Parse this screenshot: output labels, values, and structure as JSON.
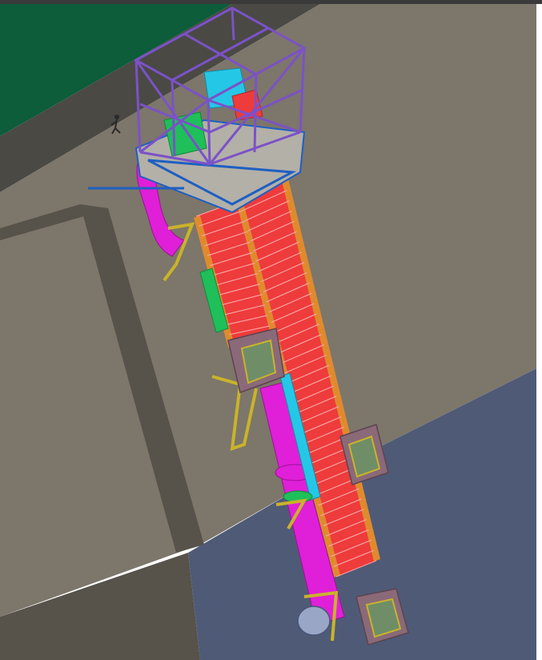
{
  "viewport": {
    "background": "#ffffff",
    "top_border_color": "#3a3a3a"
  },
  "scene": {
    "grass_color": "#0d5c3a",
    "road_color": "#4a4944",
    "wall_color": "#7d766a",
    "wall_shadow_color": "#57524a",
    "water_color": "#4f5a77",
    "steel_purple": "#7b52c7",
    "chute_red": "#ee3b3b",
    "rail_orange": "#e08a2e",
    "pipe_magenta": "#e01fd8",
    "cyan": "#25c7e6",
    "green": "#1fbf5a",
    "yellow": "#c9b32b",
    "blue": "#1f5fc2",
    "frame_mauve": "#8a6a78"
  }
}
